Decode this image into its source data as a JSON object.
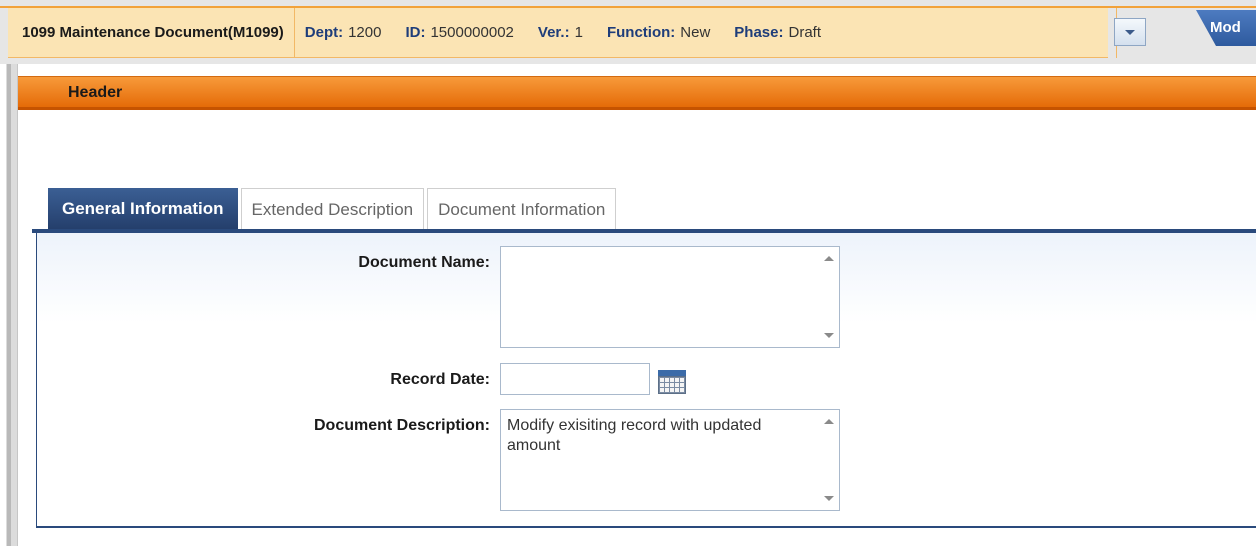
{
  "topbar": {
    "doc_title": "1099 Maintenance Document(M1099)",
    "fields": [
      {
        "label": "Dept:",
        "value": "1200"
      },
      {
        "label": "ID:",
        "value": "1500000002"
      },
      {
        "label": "Ver.:",
        "value": "1"
      },
      {
        "label": "Function:",
        "value": "New"
      },
      {
        "label": "Phase:",
        "value": "Draft"
      }
    ],
    "mode_tab_label": "Mod"
  },
  "section": {
    "title": "Header"
  },
  "tabs": [
    {
      "label": "General Information",
      "active": true
    },
    {
      "label": "Extended Description",
      "active": false
    },
    {
      "label": "Document Information",
      "active": false
    }
  ],
  "form": {
    "document_name_label": "Document Name:",
    "document_name_value": "",
    "record_date_label": "Record Date:",
    "record_date_value": "",
    "document_description_label": "Document Description:",
    "document_description_value": "Modify exisiting record with updated amount"
  },
  "colors": {
    "accent_orange": "#e56b08",
    "navy": "#2a4a7c",
    "header_bg": "#fbe4b4"
  }
}
